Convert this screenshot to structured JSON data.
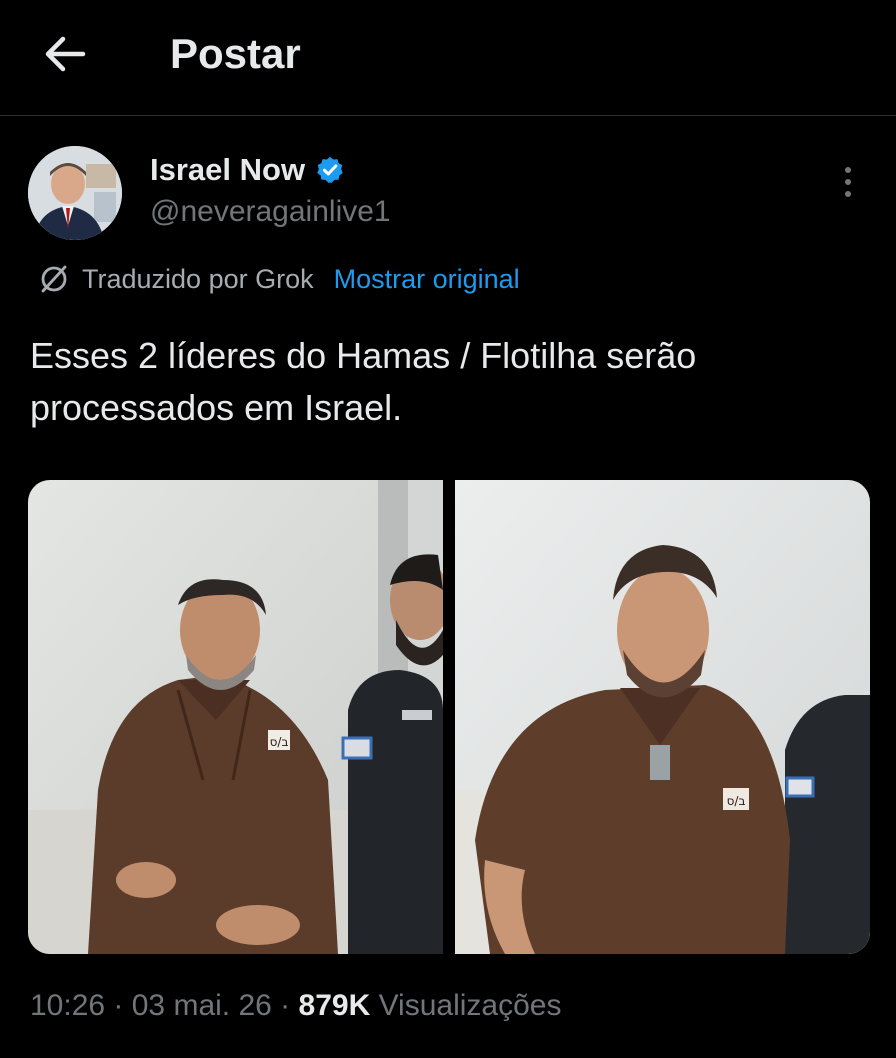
{
  "header": {
    "title": "Postar",
    "back_icon": "arrow-left-icon"
  },
  "post": {
    "author": {
      "display_name": "Israel Now",
      "handle": "@neveragainlive1",
      "verified": true,
      "verified_color": "#1d9bf0"
    },
    "translation": {
      "label": "Traduzido por Grok",
      "show_original": "Mostrar original",
      "icon": "grok-icon"
    },
    "text_line1": "Esses 2 líderes do Hamas / Flotilha serão",
    "text_line2": "processados em Israel.",
    "media": [
      {
        "type": "photo",
        "badge_text": "ב/ס"
      },
      {
        "type": "photo",
        "badge_text": "ב/ס"
      }
    ],
    "meta": {
      "time": "10:26",
      "separator": " · ",
      "date": "03 mai. 26",
      "views_count": "879K",
      "views_label": "Visualizações"
    }
  },
  "colors": {
    "background": "#000000",
    "text": "#e7e9ea",
    "secondary_text": "#71767b",
    "link": "#1d9bf0",
    "divider": "#2f3336"
  }
}
